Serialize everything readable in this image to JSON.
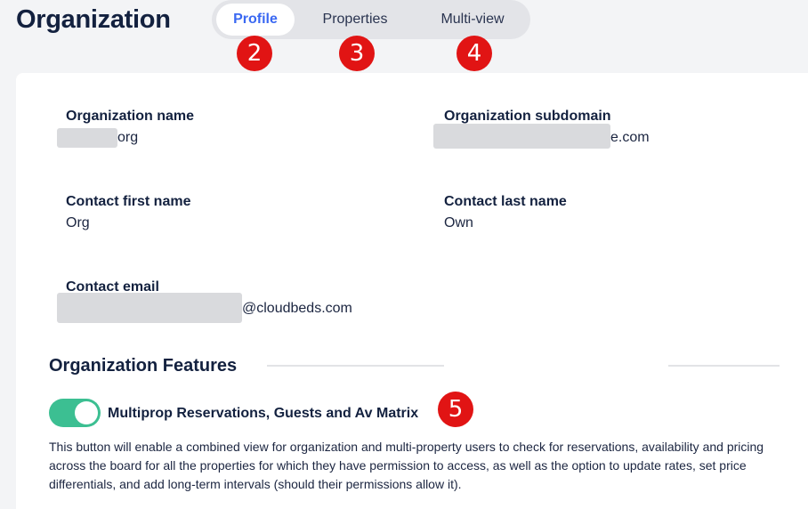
{
  "page": {
    "title": "Organization"
  },
  "tabs": [
    {
      "label": "Profile",
      "active": true
    },
    {
      "label": "Properties",
      "active": false
    },
    {
      "label": "Multi-view",
      "active": false
    }
  ],
  "markers": [
    "2",
    "3",
    "4",
    "5"
  ],
  "profile": {
    "org_name": {
      "label": "Organization name",
      "value": "org"
    },
    "org_subdomain": {
      "label": "Organization subdomain",
      "value": "e.com"
    },
    "contact_first": {
      "label": "Contact first name",
      "value": "Org"
    },
    "contact_last": {
      "label": "Contact last name",
      "value": "Own"
    },
    "contact_email": {
      "label": "Contact email",
      "value": "@cloudbeds.com"
    }
  },
  "features": {
    "title": "Organization Features",
    "items": [
      {
        "label": "Multiprop Reservations, Guests and Av Matrix",
        "enabled": true,
        "description": "This button will enable a combined view for organization and multi-property users to check for reservations, availability and pricing across the board for all the properties for which they have permission to access, as well as the option to update rates, set price differentials, and add long-term intervals (should their permissions allow it)."
      }
    ]
  },
  "colors": {
    "accent": "#3a68f2",
    "toggle_on": "#3cbf92",
    "marker": "#e11414"
  }
}
